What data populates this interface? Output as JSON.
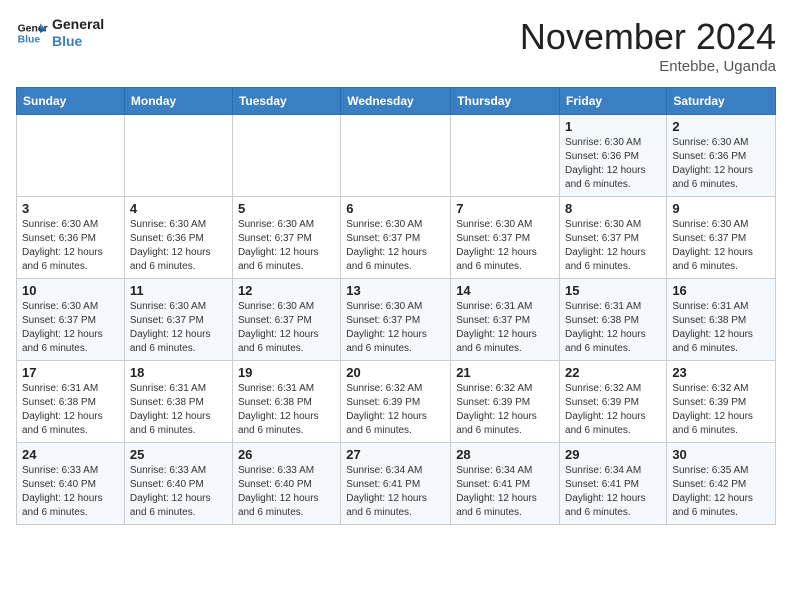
{
  "logo": {
    "line1": "General",
    "line2": "Blue"
  },
  "title": "November 2024",
  "location": "Entebbe, Uganda",
  "days_of_week": [
    "Sunday",
    "Monday",
    "Tuesday",
    "Wednesday",
    "Thursday",
    "Friday",
    "Saturday"
  ],
  "weeks": [
    [
      {
        "day": "",
        "info": ""
      },
      {
        "day": "",
        "info": ""
      },
      {
        "day": "",
        "info": ""
      },
      {
        "day": "",
        "info": ""
      },
      {
        "day": "",
        "info": ""
      },
      {
        "day": "1",
        "info": "Sunrise: 6:30 AM\nSunset: 6:36 PM\nDaylight: 12 hours and 6 minutes."
      },
      {
        "day": "2",
        "info": "Sunrise: 6:30 AM\nSunset: 6:36 PM\nDaylight: 12 hours and 6 minutes."
      }
    ],
    [
      {
        "day": "3",
        "info": "Sunrise: 6:30 AM\nSunset: 6:36 PM\nDaylight: 12 hours and 6 minutes."
      },
      {
        "day": "4",
        "info": "Sunrise: 6:30 AM\nSunset: 6:36 PM\nDaylight: 12 hours and 6 minutes."
      },
      {
        "day": "5",
        "info": "Sunrise: 6:30 AM\nSunset: 6:37 PM\nDaylight: 12 hours and 6 minutes."
      },
      {
        "day": "6",
        "info": "Sunrise: 6:30 AM\nSunset: 6:37 PM\nDaylight: 12 hours and 6 minutes."
      },
      {
        "day": "7",
        "info": "Sunrise: 6:30 AM\nSunset: 6:37 PM\nDaylight: 12 hours and 6 minutes."
      },
      {
        "day": "8",
        "info": "Sunrise: 6:30 AM\nSunset: 6:37 PM\nDaylight: 12 hours and 6 minutes."
      },
      {
        "day": "9",
        "info": "Sunrise: 6:30 AM\nSunset: 6:37 PM\nDaylight: 12 hours and 6 minutes."
      }
    ],
    [
      {
        "day": "10",
        "info": "Sunrise: 6:30 AM\nSunset: 6:37 PM\nDaylight: 12 hours and 6 minutes."
      },
      {
        "day": "11",
        "info": "Sunrise: 6:30 AM\nSunset: 6:37 PM\nDaylight: 12 hours and 6 minutes."
      },
      {
        "day": "12",
        "info": "Sunrise: 6:30 AM\nSunset: 6:37 PM\nDaylight: 12 hours and 6 minutes."
      },
      {
        "day": "13",
        "info": "Sunrise: 6:30 AM\nSunset: 6:37 PM\nDaylight: 12 hours and 6 minutes."
      },
      {
        "day": "14",
        "info": "Sunrise: 6:31 AM\nSunset: 6:37 PM\nDaylight: 12 hours and 6 minutes."
      },
      {
        "day": "15",
        "info": "Sunrise: 6:31 AM\nSunset: 6:38 PM\nDaylight: 12 hours and 6 minutes."
      },
      {
        "day": "16",
        "info": "Sunrise: 6:31 AM\nSunset: 6:38 PM\nDaylight: 12 hours and 6 minutes."
      }
    ],
    [
      {
        "day": "17",
        "info": "Sunrise: 6:31 AM\nSunset: 6:38 PM\nDaylight: 12 hours and 6 minutes."
      },
      {
        "day": "18",
        "info": "Sunrise: 6:31 AM\nSunset: 6:38 PM\nDaylight: 12 hours and 6 minutes."
      },
      {
        "day": "19",
        "info": "Sunrise: 6:31 AM\nSunset: 6:38 PM\nDaylight: 12 hours and 6 minutes."
      },
      {
        "day": "20",
        "info": "Sunrise: 6:32 AM\nSunset: 6:39 PM\nDaylight: 12 hours and 6 minutes."
      },
      {
        "day": "21",
        "info": "Sunrise: 6:32 AM\nSunset: 6:39 PM\nDaylight: 12 hours and 6 minutes."
      },
      {
        "day": "22",
        "info": "Sunrise: 6:32 AM\nSunset: 6:39 PM\nDaylight: 12 hours and 6 minutes."
      },
      {
        "day": "23",
        "info": "Sunrise: 6:32 AM\nSunset: 6:39 PM\nDaylight: 12 hours and 6 minutes."
      }
    ],
    [
      {
        "day": "24",
        "info": "Sunrise: 6:33 AM\nSunset: 6:40 PM\nDaylight: 12 hours and 6 minutes."
      },
      {
        "day": "25",
        "info": "Sunrise: 6:33 AM\nSunset: 6:40 PM\nDaylight: 12 hours and 6 minutes."
      },
      {
        "day": "26",
        "info": "Sunrise: 6:33 AM\nSunset: 6:40 PM\nDaylight: 12 hours and 6 minutes."
      },
      {
        "day": "27",
        "info": "Sunrise: 6:34 AM\nSunset: 6:41 PM\nDaylight: 12 hours and 6 minutes."
      },
      {
        "day": "28",
        "info": "Sunrise: 6:34 AM\nSunset: 6:41 PM\nDaylight: 12 hours and 6 minutes."
      },
      {
        "day": "29",
        "info": "Sunrise: 6:34 AM\nSunset: 6:41 PM\nDaylight: 12 hours and 6 minutes."
      },
      {
        "day": "30",
        "info": "Sunrise: 6:35 AM\nSunset: 6:42 PM\nDaylight: 12 hours and 6 minutes."
      }
    ]
  ]
}
